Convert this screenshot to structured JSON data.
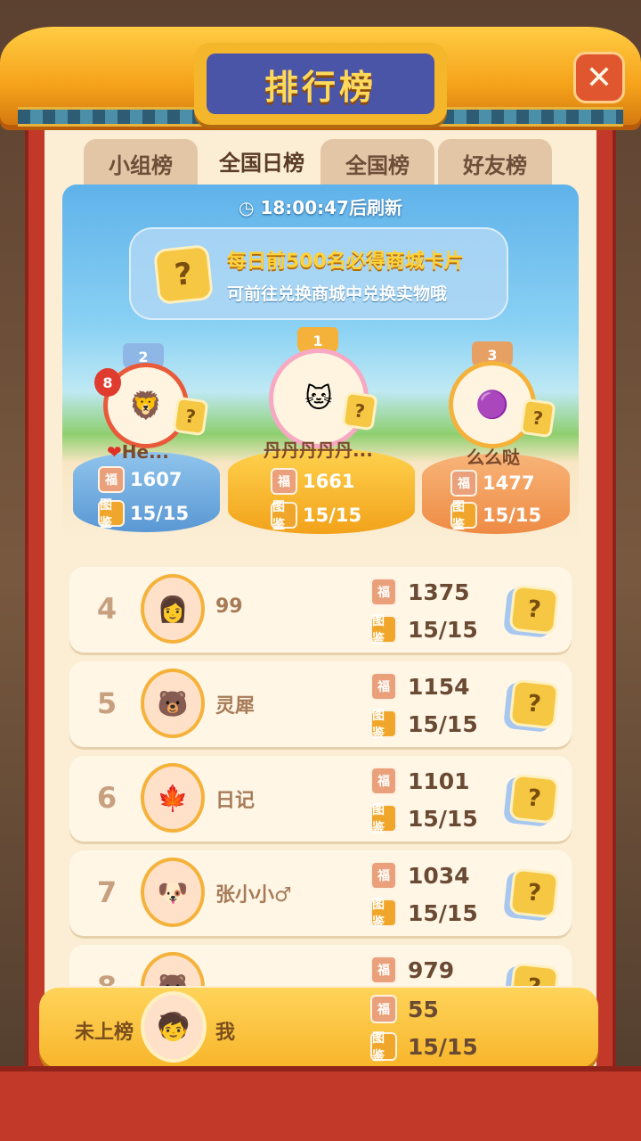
{
  "header": {
    "title": "排行榜",
    "close_label": "✕"
  },
  "tabs": [
    {
      "label": "小组榜",
      "active": false
    },
    {
      "label": "全国日榜",
      "active": true
    },
    {
      "label": "全国榜",
      "active": false
    },
    {
      "label": "好友榜",
      "active": false
    }
  ],
  "banner": {
    "refresh_time": "18:00:47",
    "refresh_text": "18:00:47后刷新",
    "notice_line1": "每日前500名必得商城卡片",
    "notice_line2": "可前往兑换商城中兑换实物哦",
    "card_symbol": "?"
  },
  "podium": {
    "first": {
      "rank": "1",
      "name": "丹丹丹丹丹...",
      "score": "1661",
      "books": "15/15"
    },
    "second": {
      "rank": "2",
      "name": "He...",
      "badge": "8",
      "score": "1607",
      "books": "15/15"
    },
    "third": {
      "rank": "3",
      "name": "么么哒",
      "score": "1477",
      "books": "15/15"
    }
  },
  "icons": {
    "fu": "福",
    "book": "图鉴"
  },
  "rows": [
    {
      "rank": "4",
      "name": "99",
      "score": "1375",
      "books": "15/15"
    },
    {
      "rank": "5",
      "name": "灵犀",
      "score": "1154",
      "books": "15/15"
    },
    {
      "rank": "6",
      "name": "日记",
      "score": "1101",
      "books": "15/15"
    },
    {
      "rank": "7",
      "name": "张小小♂",
      "score": "1034",
      "books": "15/15"
    },
    {
      "rank": "8",
      "name": "",
      "score": "979",
      "books": ""
    }
  ],
  "me": {
    "rank_text": "未上榜",
    "name": "我",
    "score": "55",
    "books": "15/15"
  },
  "colors": {
    "frame_red": "#c2392a",
    "gold": "#f5b23b",
    "title_plate": "#4b55a8",
    "panel_cream": "#fbeed5"
  }
}
